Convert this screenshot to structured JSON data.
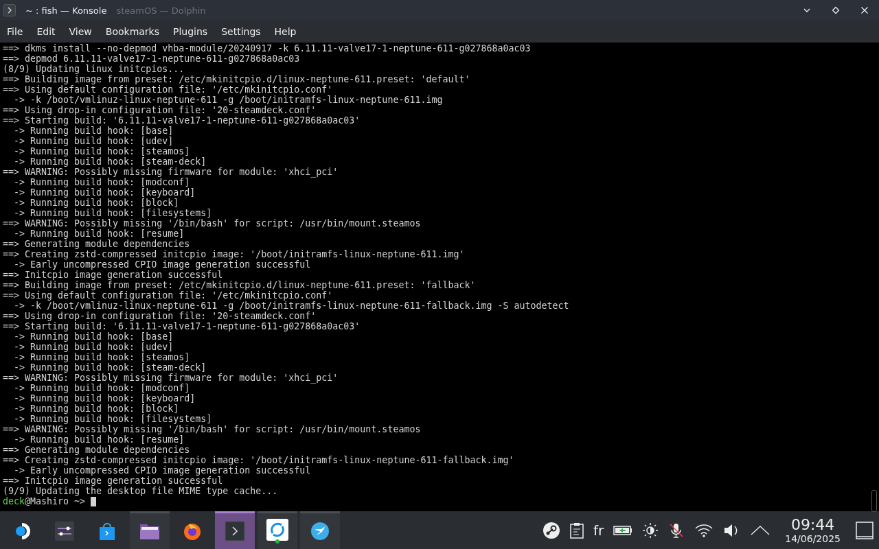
{
  "window": {
    "title": "~ : fish — Konsole",
    "background_title": "steamOS — Dolphin"
  },
  "menu": [
    "File",
    "Edit",
    "View",
    "Bookmarks",
    "Plugins",
    "Settings",
    "Help"
  ],
  "terminal": {
    "lines": [
      {
        "kind": "output",
        "text": "==> dkms install --no-depmod vhba-module/20240917 -k 6.11.11-valve17-1-neptune-611-g027868a0ac03"
      },
      {
        "kind": "output",
        "text": "==> depmod 6.11.11-valve17-1-neptune-611-g027868a0ac03"
      },
      {
        "kind": "output",
        "text": "(8/9) Updating linux initcpios..."
      },
      {
        "kind": "output",
        "text": "==> Building image from preset: /etc/mkinitcpio.d/linux-neptune-611.preset: 'default'"
      },
      {
        "kind": "output",
        "text": "==> Using default configuration file: '/etc/mkinitcpio.conf'"
      },
      {
        "kind": "output",
        "text": "  -> -k /boot/vmlinuz-linux-neptune-611 -g /boot/initramfs-linux-neptune-611.img"
      },
      {
        "kind": "output",
        "text": "==> Using drop-in configuration file: '20-steamdeck.conf'"
      },
      {
        "kind": "output",
        "text": "==> Starting build: '6.11.11-valve17-1-neptune-611-g027868a0ac03'"
      },
      {
        "kind": "output",
        "text": "  -> Running build hook: [base]"
      },
      {
        "kind": "output",
        "text": "  -> Running build hook: [udev]"
      },
      {
        "kind": "output",
        "text": "  -> Running build hook: [steamos]"
      },
      {
        "kind": "output",
        "text": "  -> Running build hook: [steam-deck]"
      },
      {
        "kind": "output",
        "text": "==> WARNING: Possibly missing firmware for module: 'xhci_pci'"
      },
      {
        "kind": "output",
        "text": "  -> Running build hook: [modconf]"
      },
      {
        "kind": "output",
        "text": "  -> Running build hook: [keyboard]"
      },
      {
        "kind": "output",
        "text": "  -> Running build hook: [block]"
      },
      {
        "kind": "output",
        "text": "  -> Running build hook: [filesystems]"
      },
      {
        "kind": "output",
        "text": "==> WARNING: Possibly missing '/bin/bash' for script: /usr/bin/mount.steamos"
      },
      {
        "kind": "output",
        "text": "  -> Running build hook: [resume]"
      },
      {
        "kind": "output",
        "text": "==> Generating module dependencies"
      },
      {
        "kind": "output",
        "text": "==> Creating zstd-compressed initcpio image: '/boot/initramfs-linux-neptune-611.img'"
      },
      {
        "kind": "output",
        "text": "  -> Early uncompressed CPIO image generation successful"
      },
      {
        "kind": "output",
        "text": "==> Initcpio image generation successful"
      },
      {
        "kind": "output",
        "text": "==> Building image from preset: /etc/mkinitcpio.d/linux-neptune-611.preset: 'fallback'"
      },
      {
        "kind": "output",
        "text": "==> Using default configuration file: '/etc/mkinitcpio.conf'"
      },
      {
        "kind": "output",
        "text": "  -> -k /boot/vmlinuz-linux-neptune-611 -g /boot/initramfs-linux-neptune-611-fallback.img -S autodetect"
      },
      {
        "kind": "output",
        "text": "==> Using drop-in configuration file: '20-steamdeck.conf'"
      },
      {
        "kind": "output",
        "text": "==> Starting build: '6.11.11-valve17-1-neptune-611-g027868a0ac03'"
      },
      {
        "kind": "output",
        "text": "  -> Running build hook: [base]"
      },
      {
        "kind": "output",
        "text": "  -> Running build hook: [udev]"
      },
      {
        "kind": "output",
        "text": "  -> Running build hook: [steamos]"
      },
      {
        "kind": "output",
        "text": "  -> Running build hook: [steam-deck]"
      },
      {
        "kind": "output",
        "text": "==> WARNING: Possibly missing firmware for module: 'xhci_pci'"
      },
      {
        "kind": "output",
        "text": "  -> Running build hook: [modconf]"
      },
      {
        "kind": "output",
        "text": "  -> Running build hook: [keyboard]"
      },
      {
        "kind": "output",
        "text": "  -> Running build hook: [block]"
      },
      {
        "kind": "output",
        "text": "  -> Running build hook: [filesystems]"
      },
      {
        "kind": "output",
        "text": "==> WARNING: Possibly missing '/bin/bash' for script: /usr/bin/mount.steamos"
      },
      {
        "kind": "output",
        "text": "  -> Running build hook: [resume]"
      },
      {
        "kind": "output",
        "text": "==> Generating module dependencies"
      },
      {
        "kind": "output",
        "text": "==> Creating zstd-compressed initcpio image: '/boot/initramfs-linux-neptune-611-fallback.img'"
      },
      {
        "kind": "output",
        "text": "  -> Early uncompressed CPIO image generation successful"
      },
      {
        "kind": "output",
        "text": "==> Initcpio image generation successful"
      },
      {
        "kind": "output",
        "text": "(9/9) Updating the desktop file MIME type cache..."
      },
      {
        "kind": "prompt",
        "user": "deck",
        "host": "@Mashiro ~>"
      }
    ]
  },
  "taskbar": {
    "items": [
      {
        "kind": "start",
        "running": false,
        "selected": false
      },
      {
        "kind": "settings",
        "running": false,
        "selected": false
      },
      {
        "kind": "store",
        "running": false,
        "selected": false
      },
      {
        "kind": "folder",
        "running": true,
        "selected": false
      },
      {
        "kind": "browser",
        "running": false,
        "selected": false
      },
      {
        "kind": "terminal",
        "running": true,
        "selected": true
      },
      {
        "kind": "sync",
        "running": true,
        "selected": false
      },
      {
        "kind": "bird",
        "running": true,
        "selected": false
      }
    ],
    "keyboard_layout": "fr",
    "microphone_muted": true,
    "time": "09:44",
    "date": "14/06/2025"
  }
}
